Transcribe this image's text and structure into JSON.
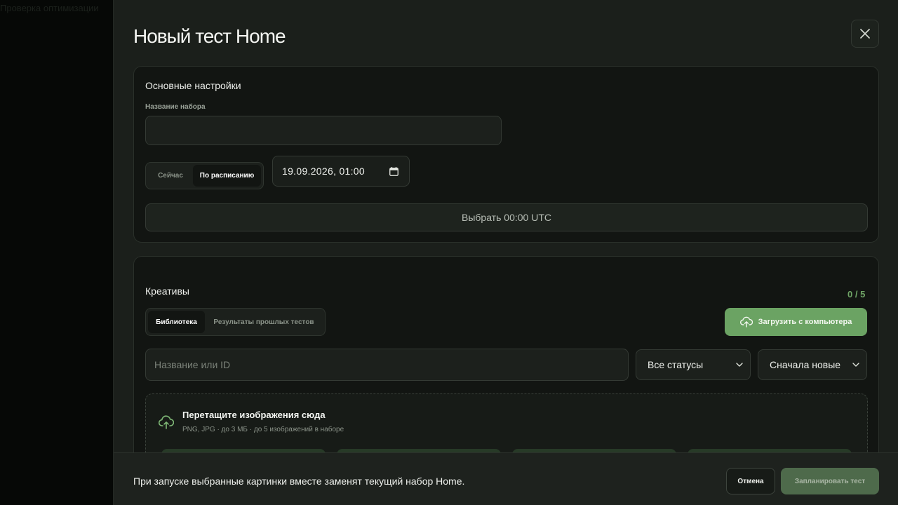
{
  "background": {
    "faded_text": "Проверка оптимизации"
  },
  "modal": {
    "title": "Новый тест Home",
    "close_icon": "close-icon"
  },
  "basic_settings": {
    "heading": "Основные настройки",
    "name_label": "Название набора",
    "name_value": "",
    "timing_options": [
      "Сейчас",
      "По расписанию"
    ],
    "timing_selected": "По расписанию",
    "datetime_value": "19.09.2026, 01:00",
    "calendar_icon": "calendar-icon",
    "utc_button_label": "Выбрать 00:00 UTC"
  },
  "creatives": {
    "heading": "Креативы",
    "counter": "0 / 5",
    "source_tabs": [
      "Библиотека",
      "Результаты прошлых тестов"
    ],
    "source_selected": "Библиотека",
    "upload_button_label": "Загрузить с компьютера",
    "upload_icon": "cloud-upload-icon",
    "search_placeholder": "Название или ID",
    "search_value": "",
    "status_filter": "Все статусы",
    "sort_filter": "Сначала новые",
    "dropzone_title": "Перетащите изображения сюда",
    "dropzone_subtitle": "PNG, JPG · до 3 МБ · до 5 изображений в наборе"
  },
  "footer": {
    "note": "При запуске выбранные картинки вместе заменят текущий набор Home.",
    "cancel_label": "Отмена",
    "submit_label": "Запланировать тест"
  },
  "colors": {
    "accent": "#6ba363",
    "accent_muted": "#4e6a4b",
    "panel": "#1b1f1b",
    "card": "#121512"
  }
}
